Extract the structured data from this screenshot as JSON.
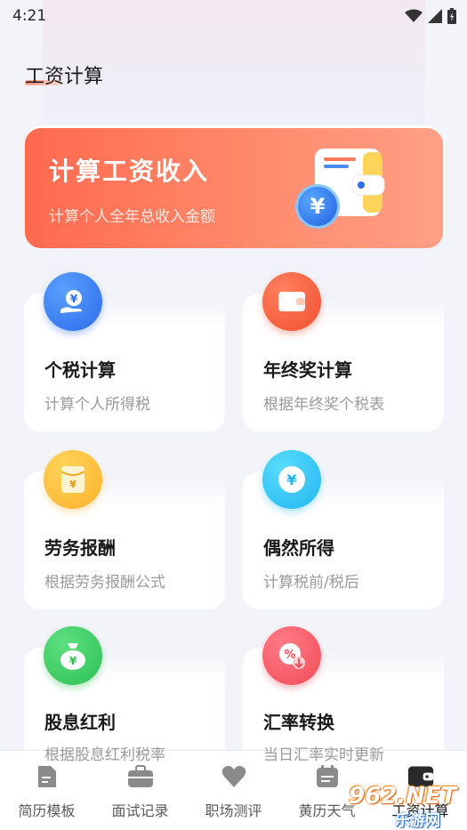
{
  "status_bar": {
    "time": "4:21"
  },
  "page": {
    "title": "工资计算"
  },
  "hero": {
    "title": "计算工资收入",
    "subtitle": "计算个人全年总收入金额",
    "coin_symbol": "¥"
  },
  "cards": [
    {
      "title": "个税计算",
      "subtitle": "计算个人所得税",
      "icon": "hand-yen-icon",
      "color": "#2c6be8"
    },
    {
      "title": "年终奖计算",
      "subtitle": "根据年终奖个税表",
      "icon": "wallet-icon",
      "color": "#f1512f"
    },
    {
      "title": "劳务报酬",
      "subtitle": "根据劳务报酬公式",
      "icon": "envelope-yen-icon",
      "color": "#fbb22a"
    },
    {
      "title": "偶然所得",
      "subtitle": "计算税前/税后",
      "icon": "coin-yen-icon",
      "color": "#22b6f0"
    },
    {
      "title": "股息红利",
      "subtitle": "根据股息红利税率",
      "icon": "money-bag-icon",
      "color": "#2cbf53"
    },
    {
      "title": "汇率转换",
      "subtitle": "当日汇率实时更新",
      "icon": "percent-exchange-icon",
      "color": "#f04b58"
    }
  ],
  "bottom_nav": [
    {
      "label": "简历模板",
      "icon": "document-icon"
    },
    {
      "label": "面试记录",
      "icon": "briefcase-icon"
    },
    {
      "label": "职场测评",
      "icon": "heart-icon"
    },
    {
      "label": "黄历天气",
      "icon": "calendar-icon"
    },
    {
      "label": "工资计算",
      "icon": "wallet-icon",
      "active": true
    }
  ],
  "watermark": {
    "number": "962.NET",
    "text": "乐游网"
  }
}
